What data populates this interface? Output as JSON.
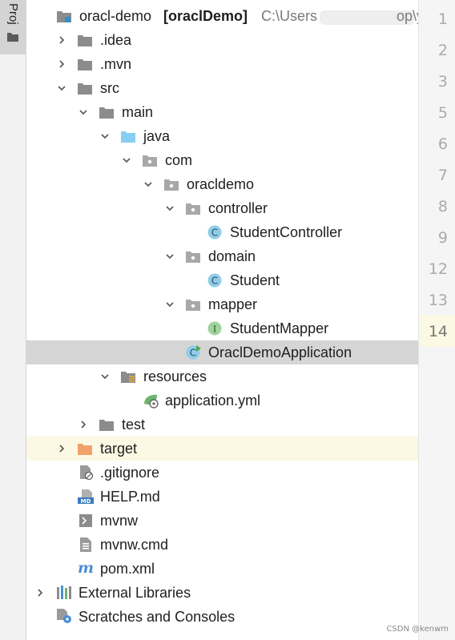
{
  "side_panel": {
    "tab_label": "Proj"
  },
  "tree": {
    "root": {
      "name": "oracl-demo",
      "module": "[oraclDemo]",
      "path_start": "C:\\Users",
      "path_end": "op\\y"
    },
    "items": [
      {
        "label": ".idea"
      },
      {
        "label": ".mvn"
      },
      {
        "label": "src"
      },
      {
        "label": "main"
      },
      {
        "label": "java"
      },
      {
        "label": "com"
      },
      {
        "label": "oracldemo"
      },
      {
        "label": "controller"
      },
      {
        "label": "StudentController"
      },
      {
        "label": "domain"
      },
      {
        "label": "Student"
      },
      {
        "label": "mapper"
      },
      {
        "label": "StudentMapper"
      },
      {
        "label": "OraclDemoApplication"
      },
      {
        "label": "resources"
      },
      {
        "label": "application.yml"
      },
      {
        "label": "test"
      },
      {
        "label": "target"
      },
      {
        "label": ".gitignore"
      },
      {
        "label": "HELP.md"
      },
      {
        "label": "mvnw"
      },
      {
        "label": "mvnw.cmd"
      },
      {
        "label": "pom.xml"
      },
      {
        "label": "External Libraries"
      },
      {
        "label": "Scratches and Consoles"
      }
    ]
  },
  "gutter": {
    "line_numbers": [
      "1",
      "2",
      "3",
      "5",
      "6",
      "7",
      "8",
      "9",
      "12",
      "13",
      "14"
    ]
  },
  "icon_glyphs": {
    "class": "C",
    "interface": "I",
    "markdown": "MD",
    "maven": "m"
  },
  "watermark": "CSDN @kenwm"
}
